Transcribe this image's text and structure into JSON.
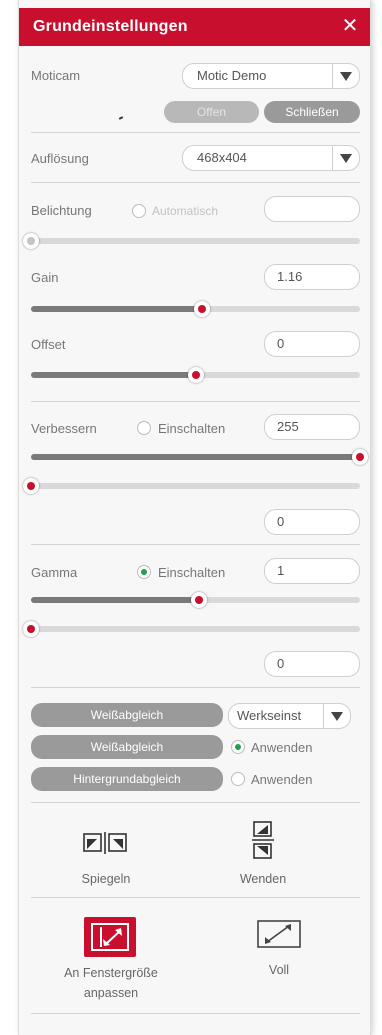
{
  "header": {
    "title": "Grundeinstellungen",
    "close_glyph": "✕"
  },
  "camera": {
    "label": "Moticam",
    "selected": "Motic Demo",
    "open_label": "Offen",
    "close_label": "Schließen"
  },
  "resolution": {
    "label": "Auflösung",
    "selected": "468x404"
  },
  "exposure": {
    "label": "Belichtung",
    "auto_label": "Automatisch",
    "value": "",
    "slider_fraction": 0.0
  },
  "gain": {
    "label": "Gain",
    "value": "1.16",
    "slider_fraction": 0.52
  },
  "offset": {
    "label": "Offset",
    "value": "0",
    "slider_fraction": 0.5
  },
  "enhance": {
    "label": "Verbessern",
    "enable_label": "Einschalten",
    "value": "255",
    "slider1_fraction": 1.0,
    "slider2_fraction": 0.0,
    "value2": "0"
  },
  "gamma": {
    "label": "Gamma",
    "enable_label": "Einschalten",
    "enabled": true,
    "value": "1",
    "slider1_fraction": 0.51,
    "slider2_fraction": 0.0,
    "value2": "0"
  },
  "white_balance": {
    "button1": "Weißabgleich",
    "preset": "Werkseinst",
    "button2": "Weißabgleich",
    "apply_label": "Anwenden",
    "apply_checked": true,
    "background_button": "Hintergrundabgleich",
    "background_apply_label": "Anwenden",
    "background_apply_checked": false
  },
  "transform": {
    "mirror_label": "Spiegeln",
    "flip_label": "Wenden"
  },
  "fit": {
    "fit_label_line1": "An Fenstergröße",
    "fit_label_line2": "anpassen",
    "full_label": "Voll"
  },
  "colors": {
    "accent": "#c8102e",
    "active_radio": "#1fa34a"
  }
}
